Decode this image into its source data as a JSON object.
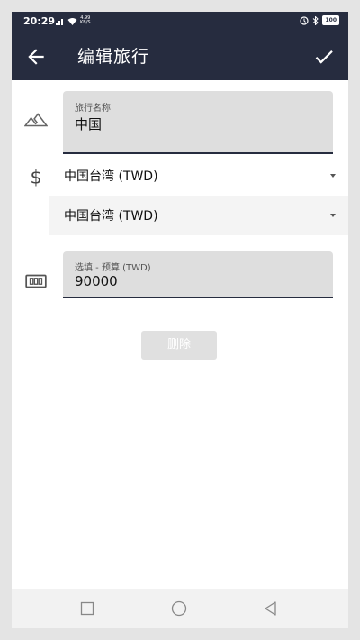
{
  "status_bar": {
    "time": "20:29",
    "network_label": "4.99\nKB/S",
    "battery": "100"
  },
  "toolbar": {
    "title": "编辑旅行",
    "back_icon": "arrow-back-icon",
    "confirm_icon": "check-icon"
  },
  "form": {
    "trip_name": {
      "label": "旅行名称",
      "value": "中国",
      "icon": "terrain-icon"
    },
    "currency": {
      "icon": "dollar-icon",
      "primary": "中国台湾 (TWD)",
      "secondary": "中国台湾 (TWD)"
    },
    "budget": {
      "label": "选填 - 预算 (TWD)",
      "value": "90000",
      "icon": "money-icon"
    },
    "delete_label": "删除"
  },
  "colors": {
    "primary": "#262c3f",
    "field_bg": "#dedede",
    "nav_bg": "#f2f2f2"
  }
}
